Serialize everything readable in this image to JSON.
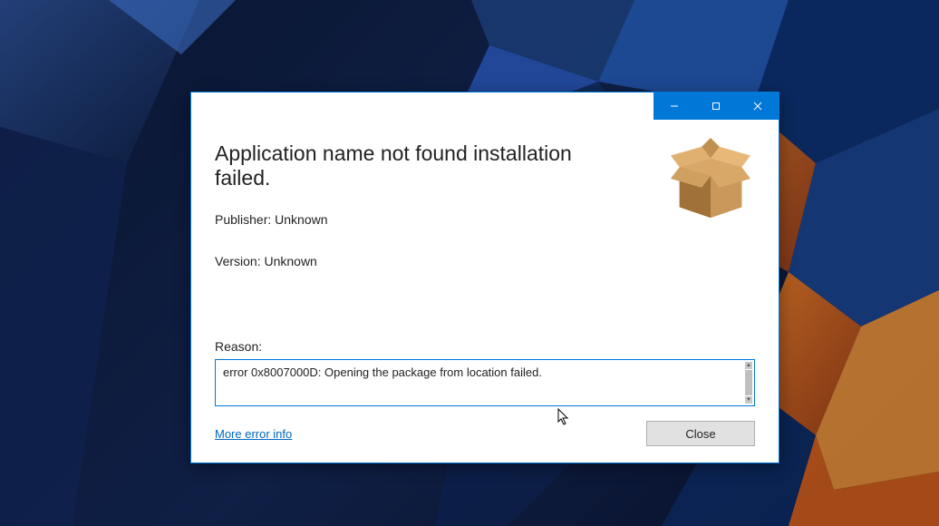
{
  "dialog": {
    "title": "Application name not found installation failed.",
    "publisher_label": "Publisher: Unknown",
    "version_label": "Version: Unknown",
    "reason_label": "Reason:",
    "reason_text": "error 0x8007000D: Opening the package from location  failed.",
    "more_info_link": "More error info",
    "close_button": "Close"
  }
}
